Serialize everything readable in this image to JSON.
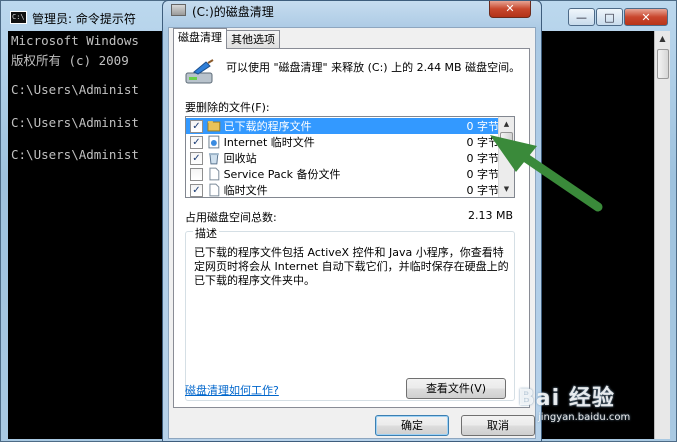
{
  "console": {
    "title": "管理员: 命令提示符",
    "icon_text": "C:\\",
    "lines": [
      "Microsoft Windows",
      "版权所有 (c) 2009",
      "C:\\Users\\Administ",
      "C:\\Users\\Administ",
      "C:\\Users\\Administ"
    ],
    "controls": {
      "minimize": "—",
      "maximize": "□",
      "close": "✕"
    }
  },
  "dialog": {
    "title": "(C:)的磁盘清理",
    "close_label": "✕",
    "tabs": [
      {
        "label": "磁盘清理",
        "active": true
      },
      {
        "label": "其他选项",
        "active": false
      }
    ],
    "intro": "可以使用 \"磁盘清理\" 来释放 (C:) 上的 2.44 MB 磁盘空间。",
    "list_label": "要删除的文件(F):",
    "files": [
      {
        "name": "已下载的程序文件",
        "size": "0 字节",
        "checked": true,
        "selected": true,
        "icon": "folder-icon"
      },
      {
        "name": "Internet 临时文件",
        "size": "0 字节",
        "checked": true,
        "selected": false,
        "icon": "internet-icon"
      },
      {
        "name": "回收站",
        "size": "0 字节",
        "checked": true,
        "selected": false,
        "icon": "recycle-bin-icon"
      },
      {
        "name": "Service Pack 备份文件",
        "size": "0 字节",
        "checked": false,
        "selected": false,
        "icon": "document-icon"
      },
      {
        "name": "临时文件",
        "size": "0 字节",
        "checked": true,
        "selected": false,
        "icon": "document-icon"
      }
    ],
    "total_label": "占用磁盘空间总数:",
    "total_value": "2.13 MB",
    "description_legend": "描述",
    "description": "已下载的程序文件包括 ActiveX 控件和 Java 小程序，你查看特定网页时将会从 Internet 自动下载它们，并临时保存在硬盘上的已下载的程序文件夹中。",
    "view_files_button": "查看文件(V)",
    "help_link": "磁盘清理如何工作?",
    "ok_button": "确定",
    "cancel_button": "取消"
  },
  "watermark": {
    "logo": "Bai 经验",
    "url": "jingyan.baidu.com"
  },
  "colors": {
    "selection": "#3399ff",
    "arrow": "#3a8a3a",
    "link": "#0066cc"
  }
}
